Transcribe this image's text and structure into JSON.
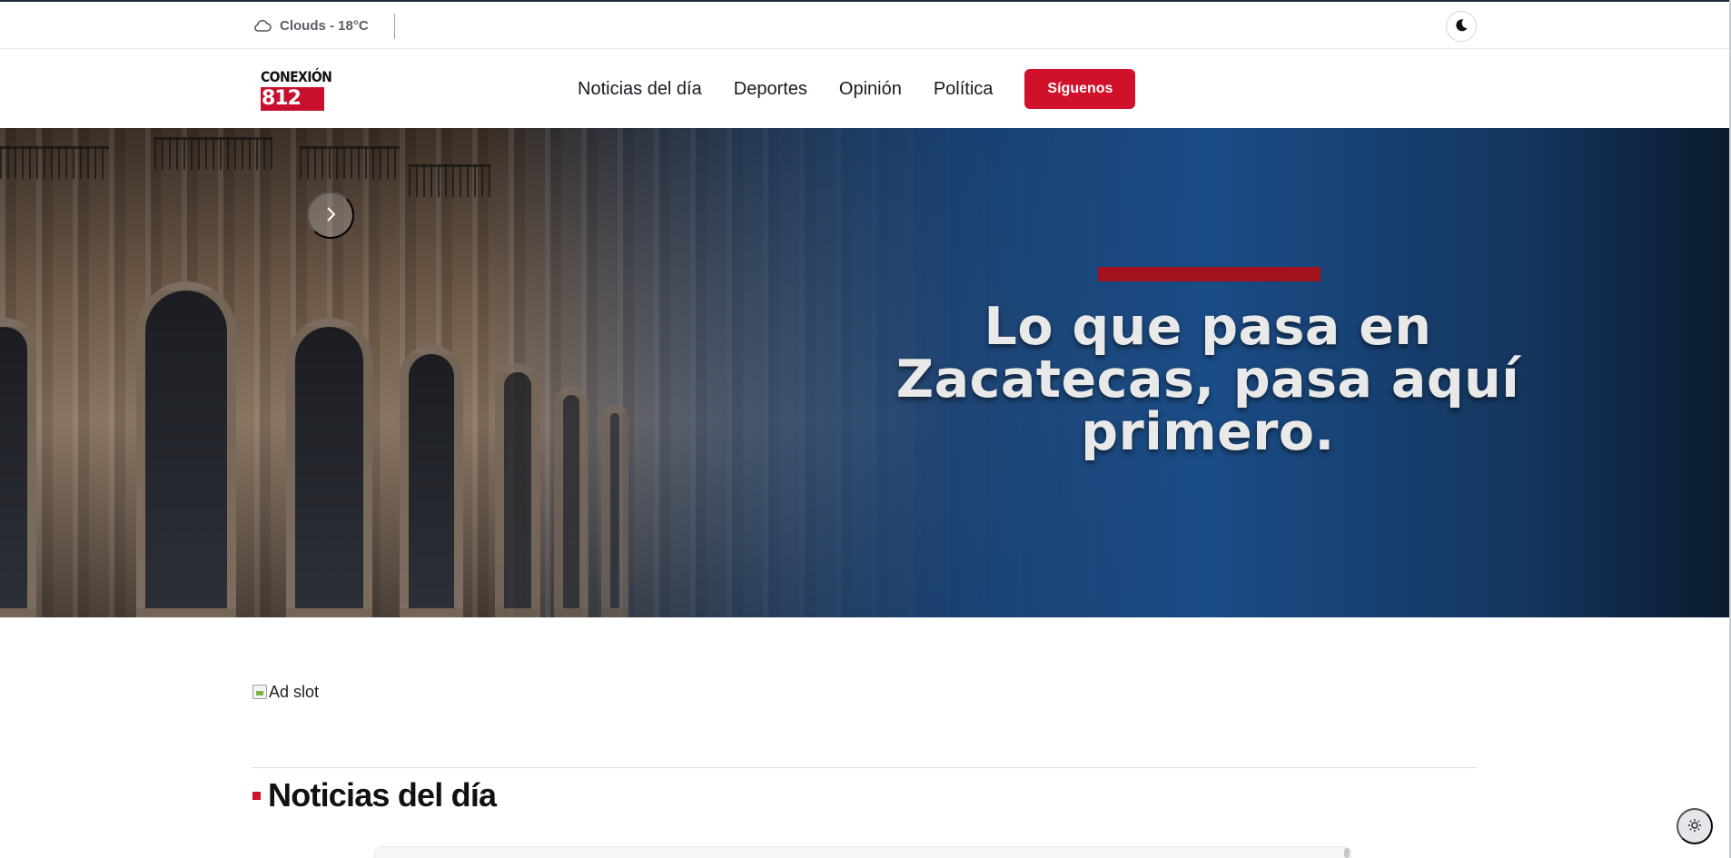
{
  "topbar": {
    "weather_icon": "cloud-icon",
    "weather_text": "Clouds - 18°C",
    "theme_toggle_icon": "moon-icon"
  },
  "nav": {
    "logo_top": "CONEXIÓN",
    "logo_bottom": "812",
    "links": [
      "Noticias del día",
      "Deportes",
      "Opinión",
      "Política"
    ],
    "follow_button": "Síguenos"
  },
  "hero": {
    "headline": "Lo que pasa en Zacatecas, pasa aquí primero.",
    "next_icon": "chevron-right-icon",
    "accent_color": "#a3111d"
  },
  "ad": {
    "alt_text": "Ad slot"
  },
  "section": {
    "title": "Noticias del día",
    "marker_color": "#d0112b"
  },
  "floating": {
    "theme_icon": "sun-icon"
  },
  "colors": {
    "brand_red": "#d0112b",
    "hero_blue": "#1a4c86",
    "text_dark": "#161b22"
  }
}
